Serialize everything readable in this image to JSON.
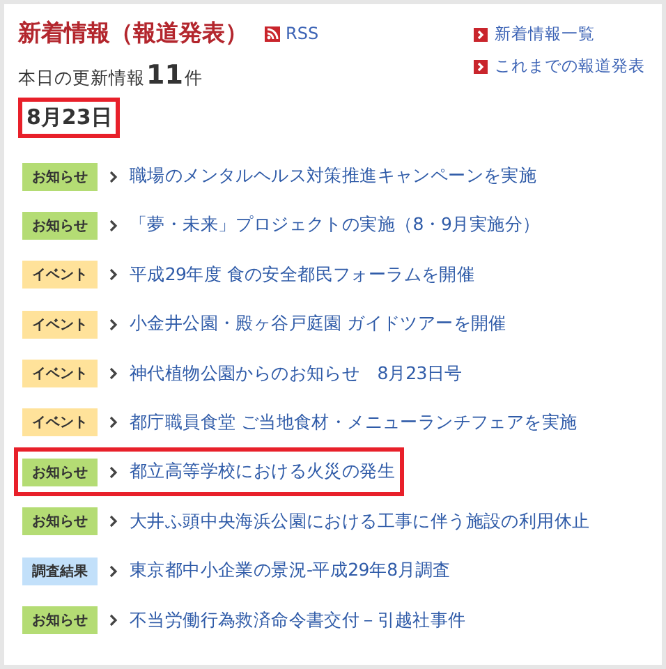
{
  "header": {
    "title": "新着情報（報道発表）",
    "rss": "RSS",
    "links": [
      "新着情報一覧",
      "これまでの報道発表"
    ]
  },
  "summary": {
    "label": "本日の更新情報",
    "count": "11",
    "unit": "件"
  },
  "date": {
    "text": "8月23日",
    "highlighted": true
  },
  "items": [
    {
      "kind": "notice",
      "tag": "お知らせ",
      "title": "職場のメンタルヘルス対策推進キャンペーンを実施",
      "highlighted": false
    },
    {
      "kind": "notice",
      "tag": "お知らせ",
      "title": "「夢・未来」プロジェクトの実施（8・9月実施分）",
      "highlighted": false
    },
    {
      "kind": "event",
      "tag": "イベント",
      "title": "平成29年度 食の安全都民フォーラムを開催",
      "highlighted": false
    },
    {
      "kind": "event",
      "tag": "イベント",
      "title": "小金井公園・殿ヶ谷戸庭園 ガイドツアーを開催",
      "highlighted": false
    },
    {
      "kind": "event",
      "tag": "イベント",
      "title": "神代植物公園からのお知らせ　8月23日号",
      "highlighted": false
    },
    {
      "kind": "event",
      "tag": "イベント",
      "title": "都庁職員食堂 ご当地食材・メニューランチフェアを実施",
      "highlighted": false
    },
    {
      "kind": "notice",
      "tag": "お知らせ",
      "title": "都立高等学校における火災の発生",
      "highlighted": true
    },
    {
      "kind": "notice",
      "tag": "お知らせ",
      "title": "大井ふ頭中央海浜公園における工事に伴う施設の利用休止",
      "highlighted": false
    },
    {
      "kind": "survey",
      "tag": "調査結果",
      "title": "東京都中小企業の景況-平成29年8月調査",
      "highlighted": false
    },
    {
      "kind": "notice",
      "tag": "お知らせ",
      "title": "不当労働行為救済命令書交付－引越社事件",
      "highlighted": false
    }
  ]
}
